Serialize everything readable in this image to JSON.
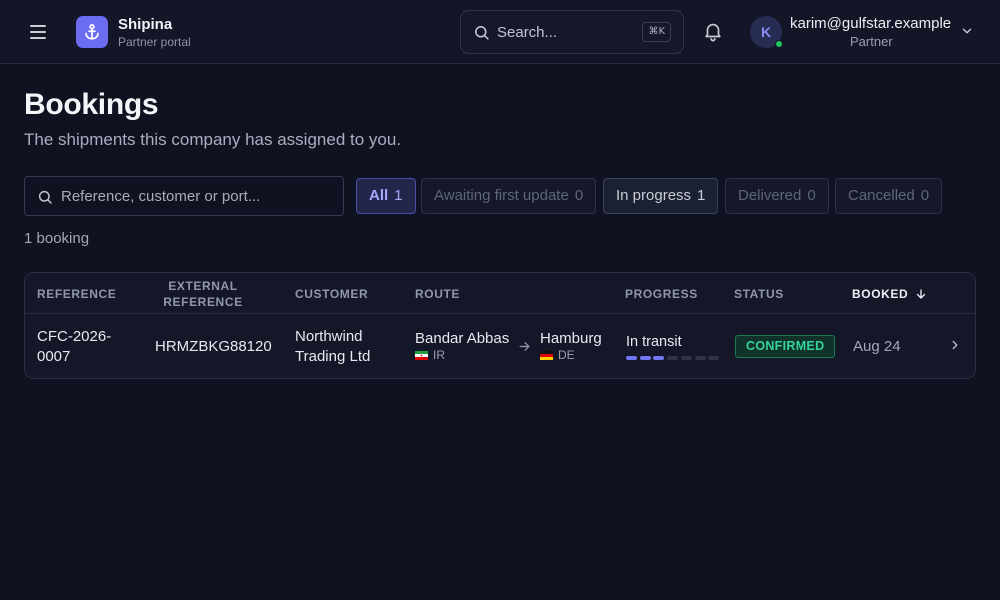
{
  "app": {
    "brand_name": "Shipina",
    "brand_subtitle": "Partner portal",
    "search_placeholder": "Search...",
    "search_shortcut": "⌘K",
    "user_initial": "K",
    "user_email": "karim@gulfstar.example",
    "user_role": "Partner",
    "icons": [
      "menu-icon",
      "anchor-icon",
      "search-icon",
      "bell-icon",
      "chevron-down-icon"
    ]
  },
  "page": {
    "title": "Bookings",
    "subtitle": "The shipments this company has assigned to you.",
    "filter_placeholder": "Reference, customer or port...",
    "result_count": "1 booking"
  },
  "filters": [
    {
      "label": "All",
      "count": "1",
      "state": "active"
    },
    {
      "label": "Awaiting first update",
      "count": "0",
      "state": "empty"
    },
    {
      "label": "In progress",
      "count": "1",
      "state": "has-items"
    },
    {
      "label": "Delivered",
      "count": "0",
      "state": "empty"
    },
    {
      "label": "Cancelled",
      "count": "0",
      "state": "empty"
    }
  ],
  "table": {
    "columns": {
      "reference": "REFERENCE",
      "external_line1": "EXTERNAL",
      "external_line2": "REFERENCE",
      "customer": "CUSTOMER",
      "route": "ROUTE",
      "progress": "PROGRESS",
      "status": "STATUS",
      "booked": "BOOKED"
    },
    "sort_column": "booked",
    "sort_direction": "descending",
    "rows": [
      {
        "reference_line1": "CFC-2026-",
        "reference_line2": "0007",
        "external_reference": "HRMZBKG88120",
        "customer_line1": "Northwind",
        "customer_line2": "Trading Ltd",
        "origin_port": "Bandar Abbas",
        "origin_country": "IR",
        "destination_port": "Hamburg",
        "destination_country": "DE",
        "progress_label": "In transit",
        "progress_steps_done": 3,
        "progress_steps_total": 7,
        "status": "CONFIRMED",
        "booked_date": "Aug 24"
      }
    ]
  },
  "colors": {
    "accent": "#6c6cf0",
    "status_confirmed": "#34d399",
    "online": "#22c55e"
  }
}
